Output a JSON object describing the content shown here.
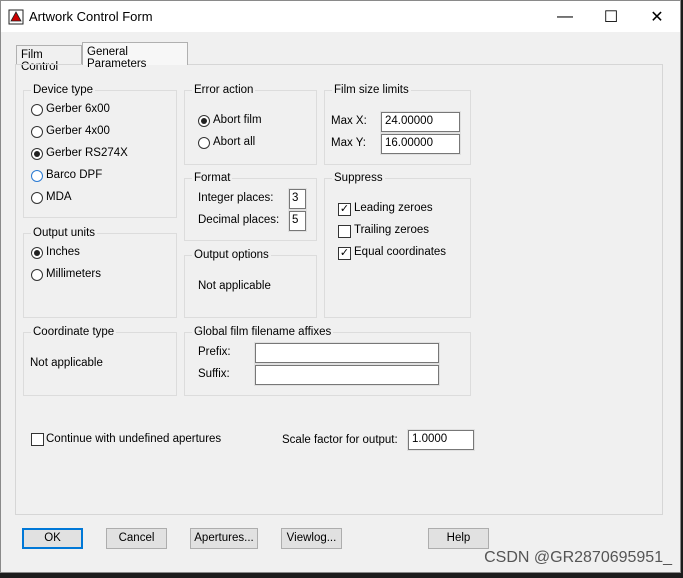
{
  "window": {
    "title": "Artwork Control Form",
    "controls": {
      "minimize": "—",
      "maximize": "☐",
      "close": "✕"
    }
  },
  "tabs": [
    {
      "label": "Film Control"
    },
    {
      "label": "General Parameters"
    }
  ],
  "device_type": {
    "label": "Device type",
    "options": [
      "Gerber 6x00",
      "Gerber 4x00",
      "Gerber RS274X",
      "Barco DPF",
      "MDA"
    ],
    "selected": "Gerber RS274X"
  },
  "output_units": {
    "label": "Output units",
    "options": [
      "Inches",
      "Millimeters"
    ],
    "selected": "Inches"
  },
  "coordinate_type": {
    "label": "Coordinate type",
    "value": "Not applicable"
  },
  "error_action": {
    "label": "Error action",
    "options": [
      "Abort film",
      "Abort all"
    ],
    "selected": "Abort film"
  },
  "format": {
    "label": "Format",
    "integer_label": "Integer places:",
    "integer_value": "3",
    "decimal_label": "Decimal places:",
    "decimal_value": "5"
  },
  "output_options": {
    "label": "Output options",
    "value": "Not applicable"
  },
  "film_size": {
    "label": "Film size limits",
    "max_x_label": "Max X:",
    "max_x": "24.00000",
    "max_y_label": "Max Y:",
    "max_y": "16.00000"
  },
  "suppress": {
    "label": "Suppress",
    "items": [
      {
        "label": "Leading zeroes",
        "checked": true
      },
      {
        "label": "Trailing zeroes",
        "checked": false
      },
      {
        "label": "Equal coordinates",
        "checked": true
      }
    ]
  },
  "affixes": {
    "label": "Global film filename affixes",
    "prefix_label": "Prefix:",
    "prefix": "",
    "suffix_label": "Suffix:",
    "suffix": ""
  },
  "continue_undefined": {
    "label": "Continue with undefined apertures",
    "checked": false
  },
  "scale_factor": {
    "label": "Scale factor for output:",
    "value": "1.0000"
  },
  "buttons": {
    "ok": "OK",
    "cancel": "Cancel",
    "apertures": "Apertures...",
    "viewlog": "Viewlog...",
    "help": "Help"
  },
  "watermark": "CSDN @GR2870695951_"
}
